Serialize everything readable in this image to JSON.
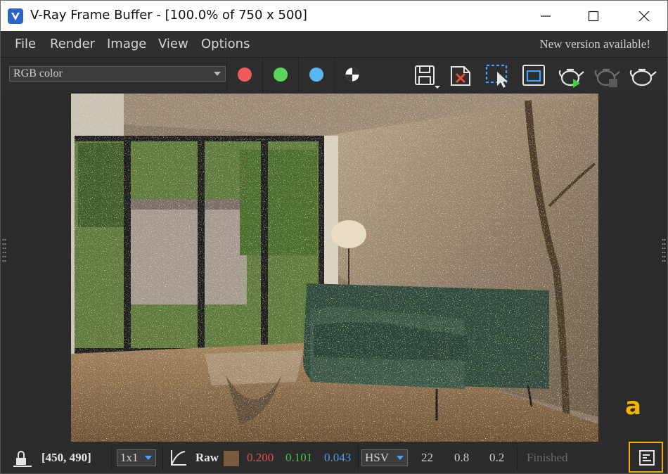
{
  "window": {
    "title": "V-Ray Frame Buffer - [100.0% of 750 x 500]",
    "controls": [
      "minimize",
      "maximize",
      "close"
    ]
  },
  "menu": {
    "items": [
      "File",
      "Render",
      "Image",
      "View",
      "Options"
    ],
    "notice": "New version available!"
  },
  "toolbar": {
    "channel": "RGB color",
    "channel_toggles": [
      {
        "name": "red-channel",
        "color": "#f05a5a"
      },
      {
        "name": "green-channel",
        "color": "#5cd35c"
      },
      {
        "name": "blue-channel",
        "color": "#5ab8f0"
      },
      {
        "name": "alpha-channel",
        "color": "#ffffff"
      }
    ],
    "tools": [
      "save-image-icon",
      "clear-image-icon",
      "region-render-icon",
      "track-mouse-icon",
      "render-interactive-icon",
      "stop-render-icon",
      "render-icon"
    ]
  },
  "render": {
    "width": 750,
    "height": 500,
    "zoom": "100.0%",
    "colors": {
      "window_frame": "#1e1e1e",
      "sofa": "#2f4a3c",
      "floor": "#8a6d4e",
      "wall": "#7a6a5a"
    }
  },
  "watermark": "a",
  "status": {
    "coords": "[450, 490]",
    "sample_size": "1x1",
    "display_mode": "Raw",
    "swatch": "#7a5a3a",
    "r": "0.200",
    "g": "0.101",
    "b": "0.043",
    "color_space": "HSV",
    "h": "22",
    "s": "0.8",
    "v": "0.2",
    "state": "Finished",
    "colors": {
      "r": "#e05050",
      "g": "#49c049",
      "b": "#4f9ae8",
      "state": "#6a6a6a"
    }
  }
}
